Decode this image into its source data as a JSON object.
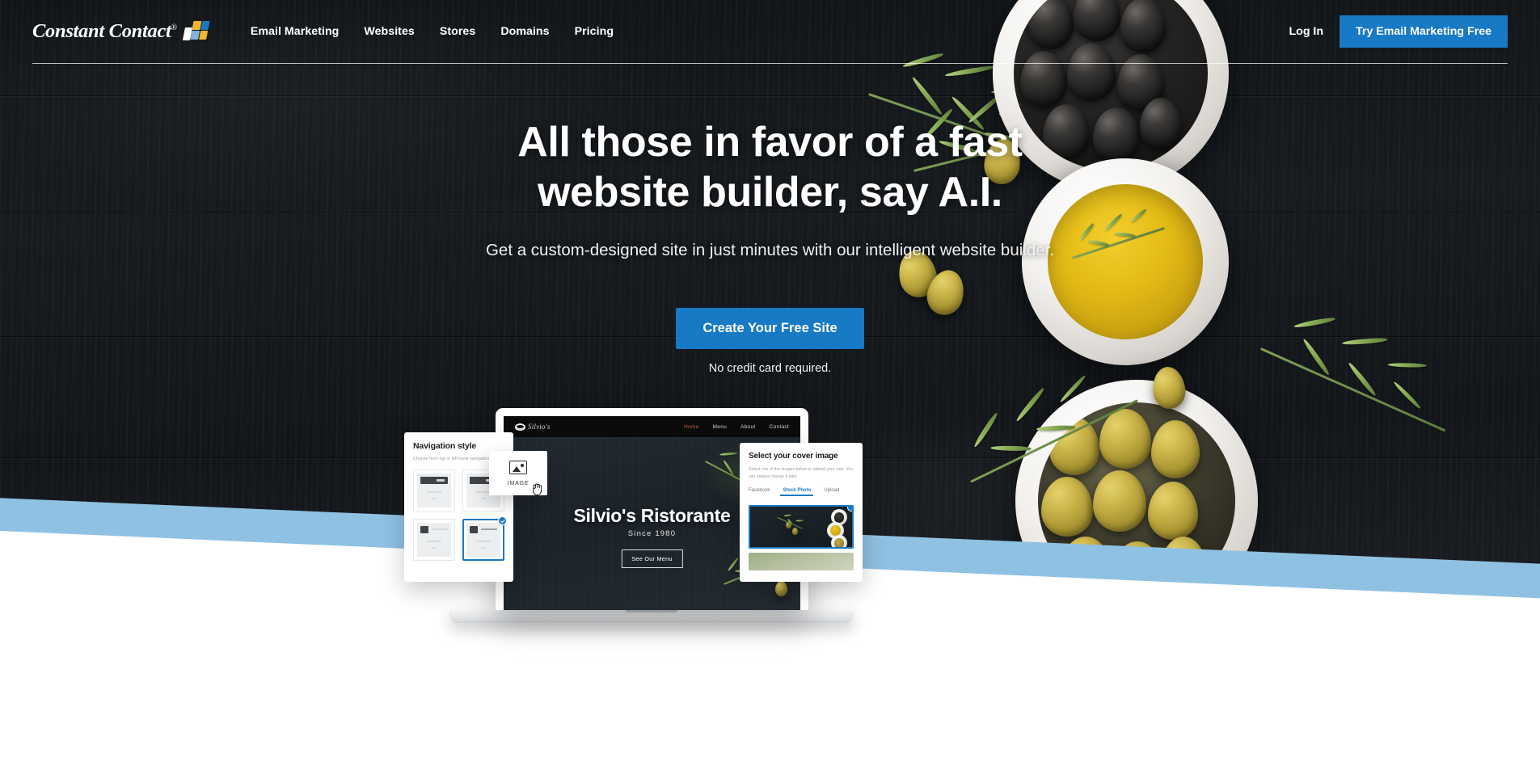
{
  "brand": {
    "name": "Constant Contact",
    "trademark": "®",
    "mark_colors": [
      "#f2b632",
      "#1879c4",
      "#ffffff",
      "#7fb2dd"
    ]
  },
  "header": {
    "nav_items": [
      {
        "label": "Email Marketing"
      },
      {
        "label": "Websites"
      },
      {
        "label": "Stores"
      },
      {
        "label": "Domains"
      },
      {
        "label": "Pricing"
      }
    ],
    "login_label": "Log In",
    "cta_label": "Try Email Marketing Free",
    "cta_color": "#1879c4"
  },
  "hero": {
    "title_line1": "All those in favor of a fast",
    "title_line2": "website builder, say A.I.",
    "subtitle": "Get a custom-designed site in just minutes with our intelligent website builder.",
    "cta_label": "Create Your Free Site",
    "cta_color": "#1879c4",
    "cta_note": "No credit card required."
  },
  "bands": {
    "blue": "#8fc1e3",
    "white": "#ffffff"
  },
  "mockup": {
    "site_preview": {
      "logo_script": "Silvio's",
      "nav_links": [
        {
          "label": "Home",
          "active": true
        },
        {
          "label": "Menu",
          "active": false
        },
        {
          "label": "About",
          "active": false
        },
        {
          "label": "Contact",
          "active": false
        }
      ],
      "active_color": "#c3593f",
      "hero_title": "Silvio's Ristorante",
      "hero_subtitle": "Since 1980",
      "hero_button": "See Our Menu"
    },
    "nav_panel": {
      "title": "Navigation style",
      "description": "Choose from top or left hand navigation.",
      "thumbnails": [
        {
          "style": "top",
          "selected": false
        },
        {
          "style": "top",
          "selected": false
        },
        {
          "style": "left",
          "selected": false
        },
        {
          "style": "left",
          "selected": true
        }
      ],
      "selected_color": "#1879c4"
    },
    "image_chip": {
      "label": "IMAGE",
      "icon": "image-icon"
    },
    "cover_panel": {
      "title": "Select your cover image",
      "description": "Select one of the images below or upload your own. You can always change it later.",
      "tabs": [
        {
          "label": "Facebook",
          "active": false
        },
        {
          "label": "Stock Photo",
          "active": true
        },
        {
          "label": "Upload",
          "active": false
        }
      ],
      "active_color": "#1879c4",
      "thumbnails": [
        {
          "name": "olives-dark-board",
          "selected": true
        },
        {
          "name": "vegetables",
          "selected": false
        }
      ]
    }
  }
}
